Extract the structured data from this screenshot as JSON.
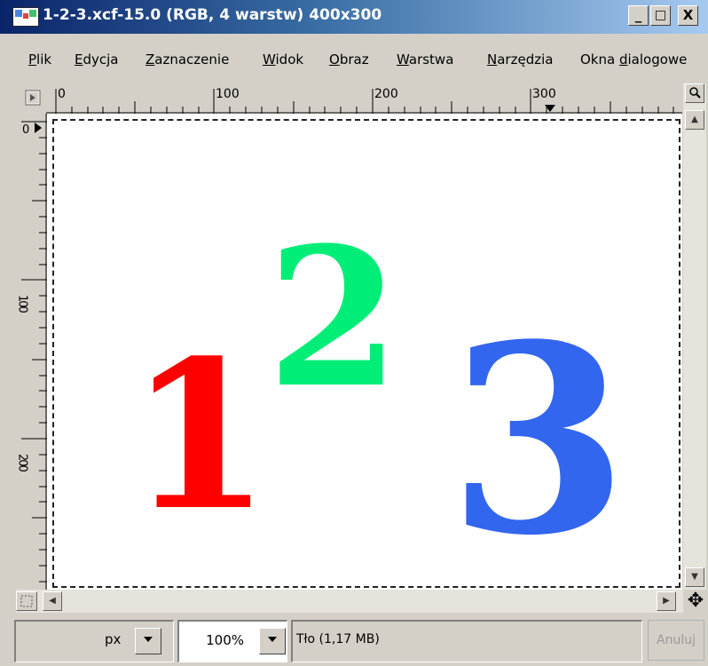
{
  "window": {
    "title": "1-2-3.xcf-15.0 (RGB, 4 warstw) 400x300",
    "minimize_glyph": "_",
    "maximize_glyph": "□",
    "close_glyph": "X"
  },
  "menu": {
    "items": [
      {
        "pre": "",
        "u": "P",
        "post": "lik"
      },
      {
        "pre": "",
        "u": "E",
        "post": "dycja"
      },
      {
        "pre": "",
        "u": "Z",
        "post": "aznaczenie"
      },
      {
        "pre": "",
        "u": "W",
        "post": "idok"
      },
      {
        "pre": "",
        "u": "O",
        "post": "braz"
      },
      {
        "pre": "",
        "u": "W",
        "post": "arstwa"
      },
      {
        "pre": "",
        "u": "N",
        "post": "arzędzia"
      },
      {
        "pre": "Okna ",
        "u": "d",
        "post": "ialogowe"
      }
    ]
  },
  "rulers": {
    "h_labels": [
      "0",
      "100",
      "200",
      "300"
    ],
    "v_labels": [
      "0",
      "100",
      "200"
    ]
  },
  "canvas": {
    "digit1": "1",
    "digit2": "2",
    "digit3": "3",
    "color1": "#ff0000",
    "color2": "#00ee77",
    "color3": "#3366ee"
  },
  "status": {
    "unit": "px",
    "zoom": "100%",
    "layer_info": "Tło (1,17 MB)",
    "cancel_label": "Anuluj"
  },
  "icons": {
    "navigate": "✥",
    "quick_mask": "quick-mask-icon",
    "zoom": "zoom-icon",
    "menu_arrow": "menu-arrow-icon"
  }
}
